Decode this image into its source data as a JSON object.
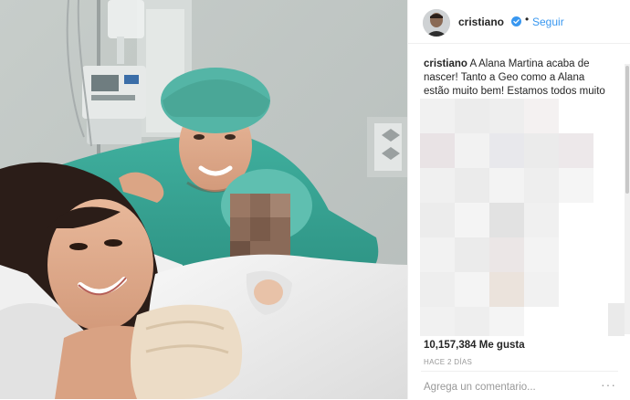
{
  "post": {
    "username": "cristiano",
    "dot": "•",
    "follow_label": "Seguir",
    "caption_user": "cristiano",
    "caption_text": " A Alana Martina acaba de nascer! Tanto a Geo como a Alana estão muito bem! Estamos todos muito felizes!",
    "heart": "♥",
    "likes": "10,157,384 Me gusta",
    "timestamp": "HACE 2 DÍAS",
    "comment_placeholder": "Agrega un comentario...",
    "more_label": "···"
  },
  "colors": {
    "link": "#3897f0",
    "text": "#262626",
    "muted": "#999999",
    "verified": "#3897f0",
    "heart": "#ed4956"
  },
  "icons": [
    "verified-badge-icon",
    "heart-emoji-icon",
    "more-options-icon"
  ]
}
